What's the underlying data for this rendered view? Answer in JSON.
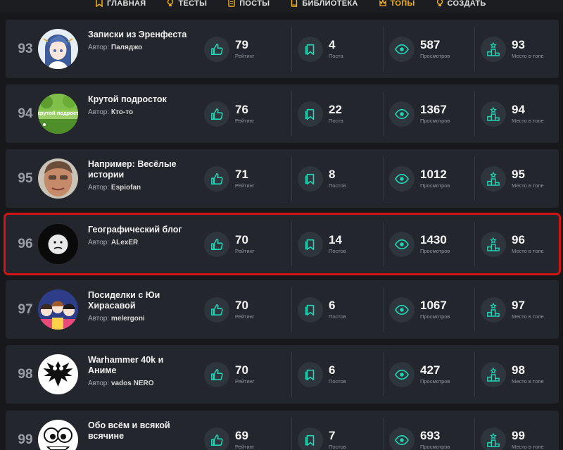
{
  "nav": {
    "items": [
      {
        "label": "ГЛАВНАЯ",
        "icon": "bookmark-icon",
        "active": false
      },
      {
        "label": "ТЕСТЫ",
        "icon": "lightbulb-icon",
        "active": false
      },
      {
        "label": "ПОСТЫ",
        "icon": "document-icon",
        "active": false
      },
      {
        "label": "БИБЛИОТЕКА",
        "icon": "book-icon",
        "active": false
      },
      {
        "label": "ТОПЫ",
        "icon": "crown-icon",
        "active": true
      },
      {
        "label": "СОЗДАТЬ",
        "icon": "lightbulb-icon",
        "active": false
      }
    ]
  },
  "colors": {
    "accent": "#20d6b5",
    "active_nav": "#f2b01e",
    "highlight_border": "#d11515",
    "card": "#23272d",
    "background": "#16181c"
  },
  "labels": {
    "author_prefix": "Автор:"
  },
  "rows": [
    {
      "rank": "93",
      "title": "Записки из Эренфеста",
      "author": "Паляджо",
      "rating": "79",
      "rating_label": "Рейтинг",
      "posts": "4",
      "posts_label": "Поста",
      "views": "587",
      "views_label": "Просмотров",
      "place": "93",
      "place_label": "Место в топе",
      "highlight": false,
      "avatar": "anime-girl"
    },
    {
      "rank": "94",
      "title": "Крутой подросток",
      "author": "Кто-то",
      "rating": "76",
      "rating_label": "Рейтинг",
      "posts": "22",
      "posts_label": "Поста",
      "views": "1367",
      "views_label": "Просмотров",
      "place": "94",
      "place_label": "Место в топе",
      "highlight": false,
      "avatar": "green-landscape",
      "avatar_text": "крутой подрост"
    },
    {
      "rank": "95",
      "title": "Например: Весёлые истории",
      "author": "Espiofan",
      "rating": "71",
      "rating_label": "Рейтинг",
      "posts": "8",
      "posts_label": "Постов",
      "views": "1012",
      "views_label": "Просмотров",
      "place": "95",
      "place_label": "Место в топе",
      "highlight": false,
      "avatar": "man-face"
    },
    {
      "rank": "96",
      "title": "Географический блог",
      "author": "ALexER",
      "rating": "70",
      "rating_label": "Рейтинг",
      "posts": "14",
      "posts_label": "Постов",
      "views": "1430",
      "views_label": "Просмотров",
      "place": "96",
      "place_label": "Место в топе",
      "highlight": true,
      "avatar": "sad-ball"
    },
    {
      "rank": "97",
      "title": "Посиделки с Юи Хирасавой",
      "author": "melergoni",
      "rating": "70",
      "rating_label": "Рейтинг",
      "posts": "6",
      "posts_label": "Постов",
      "views": "1067",
      "views_label": "Просмотров",
      "place": "97",
      "place_label": "Место в топе",
      "highlight": false,
      "avatar": "anime-group"
    },
    {
      "rank": "98",
      "title": "Warhammer 40k и Аниме",
      "author": "vados NERO",
      "rating": "70",
      "rating_label": "Рейтинг",
      "posts": "6",
      "posts_label": "Постов",
      "views": "427",
      "views_label": "Просмотров",
      "place": "98",
      "place_label": "Место в топе",
      "highlight": false,
      "avatar": "eagle-emblem"
    },
    {
      "rank": "99",
      "title": "Обо всём и всякой всячине",
      "author": "",
      "rating": "69",
      "rating_label": "Рейтинг",
      "posts": "7",
      "posts_label": "Постов",
      "views": "693",
      "views_label": "Просмотров",
      "place": "99",
      "place_label": "Место в топе",
      "highlight": false,
      "avatar": "cartoon-face"
    }
  ]
}
